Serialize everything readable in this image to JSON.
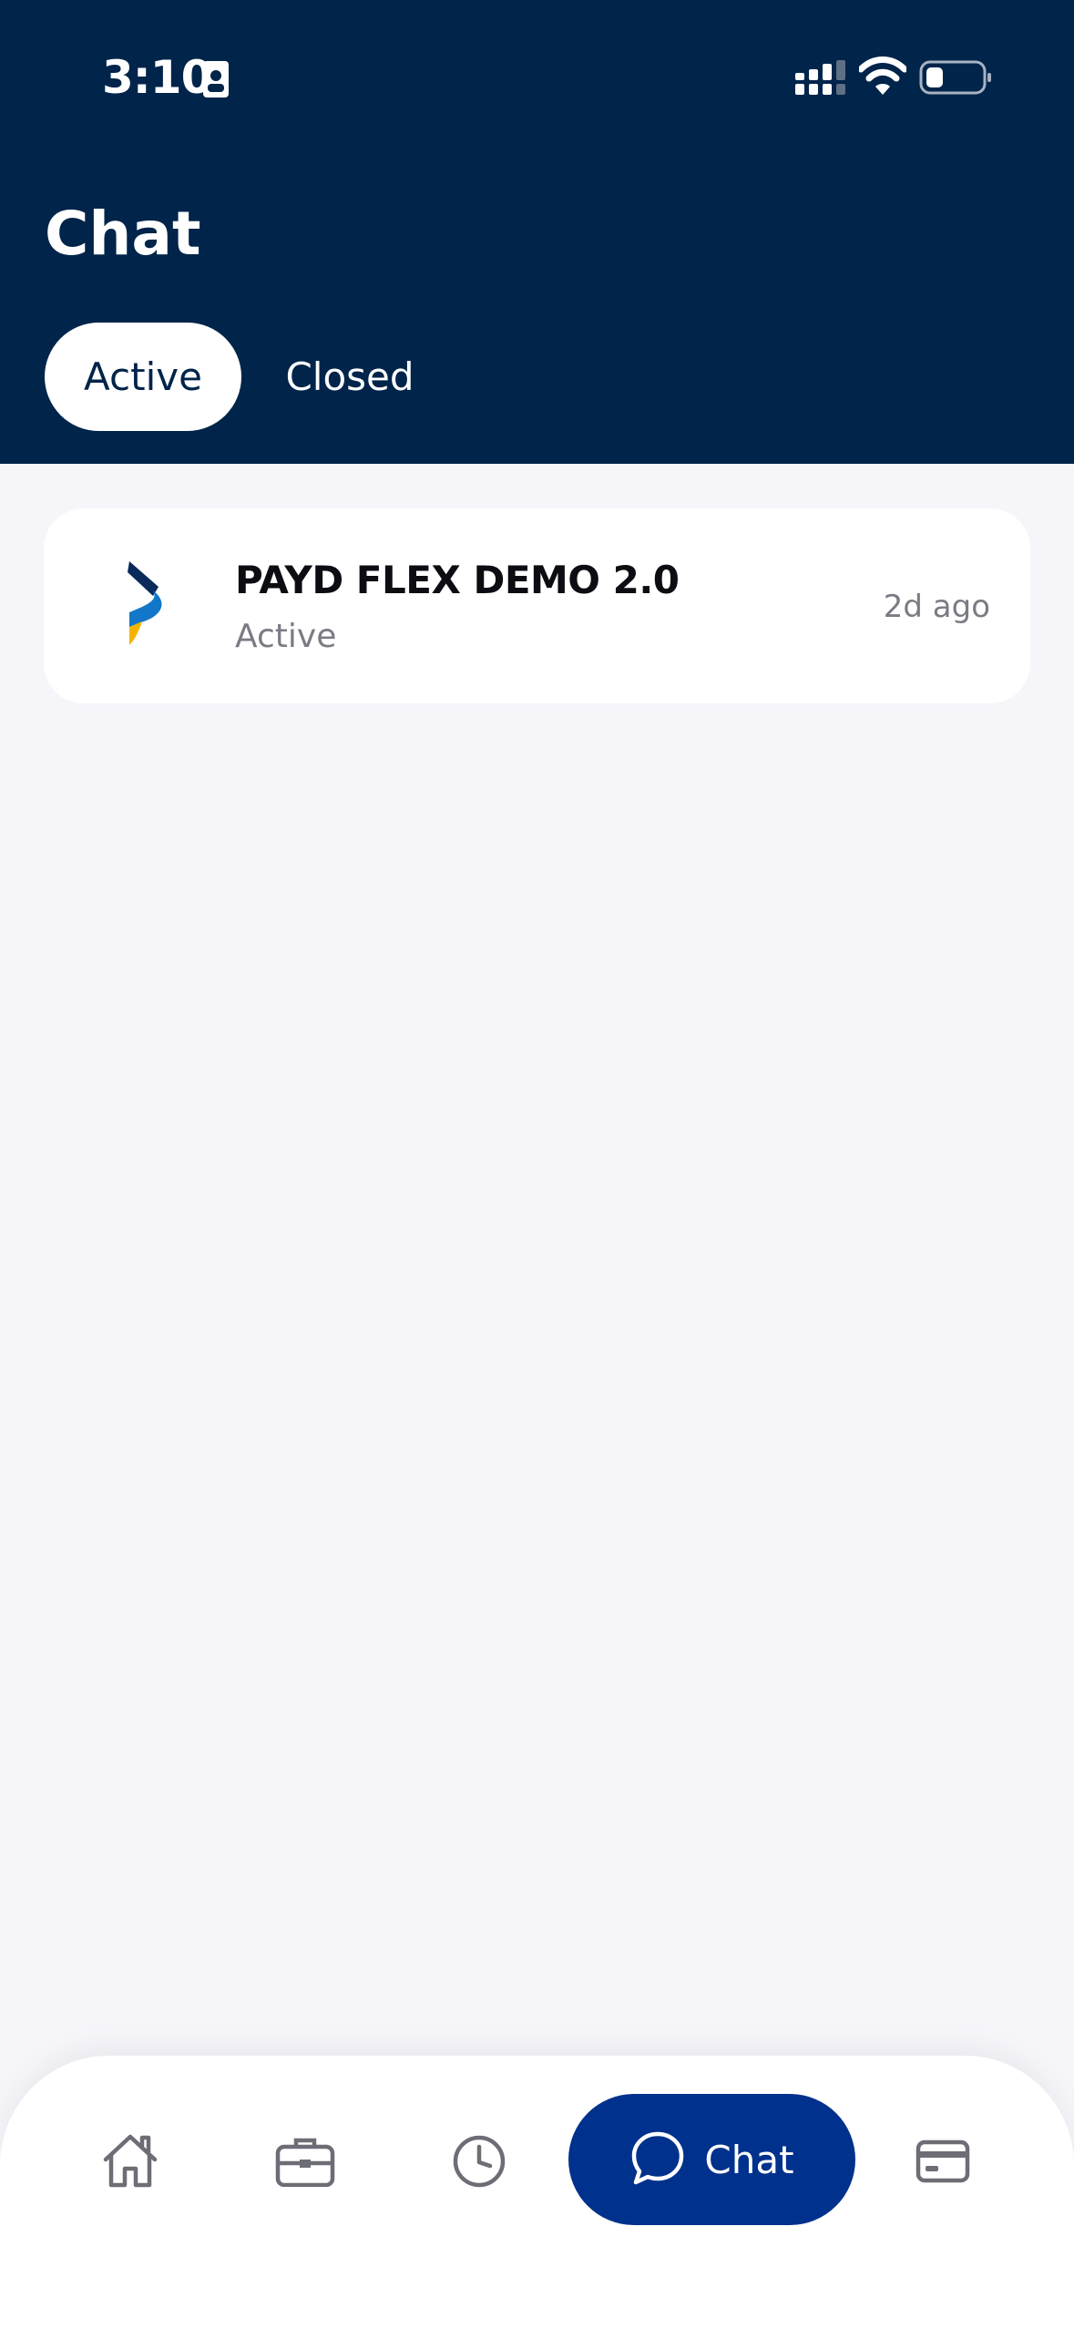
{
  "status_bar": {
    "time": "3:10",
    "icons": [
      "id-badge-icon",
      "signal-icon",
      "wifi-icon",
      "battery-icon"
    ]
  },
  "header": {
    "title": "Chat",
    "tabs": [
      {
        "label": "Active",
        "selected": true
      },
      {
        "label": "Closed",
        "selected": false
      }
    ]
  },
  "chats": [
    {
      "name": "PAYD FLEX DEMO 2.0",
      "status": "Active",
      "time": "2d ago",
      "icon": "payd-logo-icon"
    }
  ],
  "bottom_nav": {
    "items": [
      {
        "icon": "home-icon"
      },
      {
        "icon": "briefcase-icon"
      },
      {
        "icon": "clock-icon"
      },
      {
        "icon": "chat-bubble-icon",
        "label": "Chat",
        "selected": true
      },
      {
        "icon": "credit-card-icon"
      }
    ]
  },
  "colors": {
    "header_bg": "#00244a",
    "accent": "#00318c",
    "page_bg": "#f5f5fa",
    "logo_dark": "#0a2a5c",
    "logo_blue": "#1277c9",
    "logo_yellow": "#f5b400"
  }
}
